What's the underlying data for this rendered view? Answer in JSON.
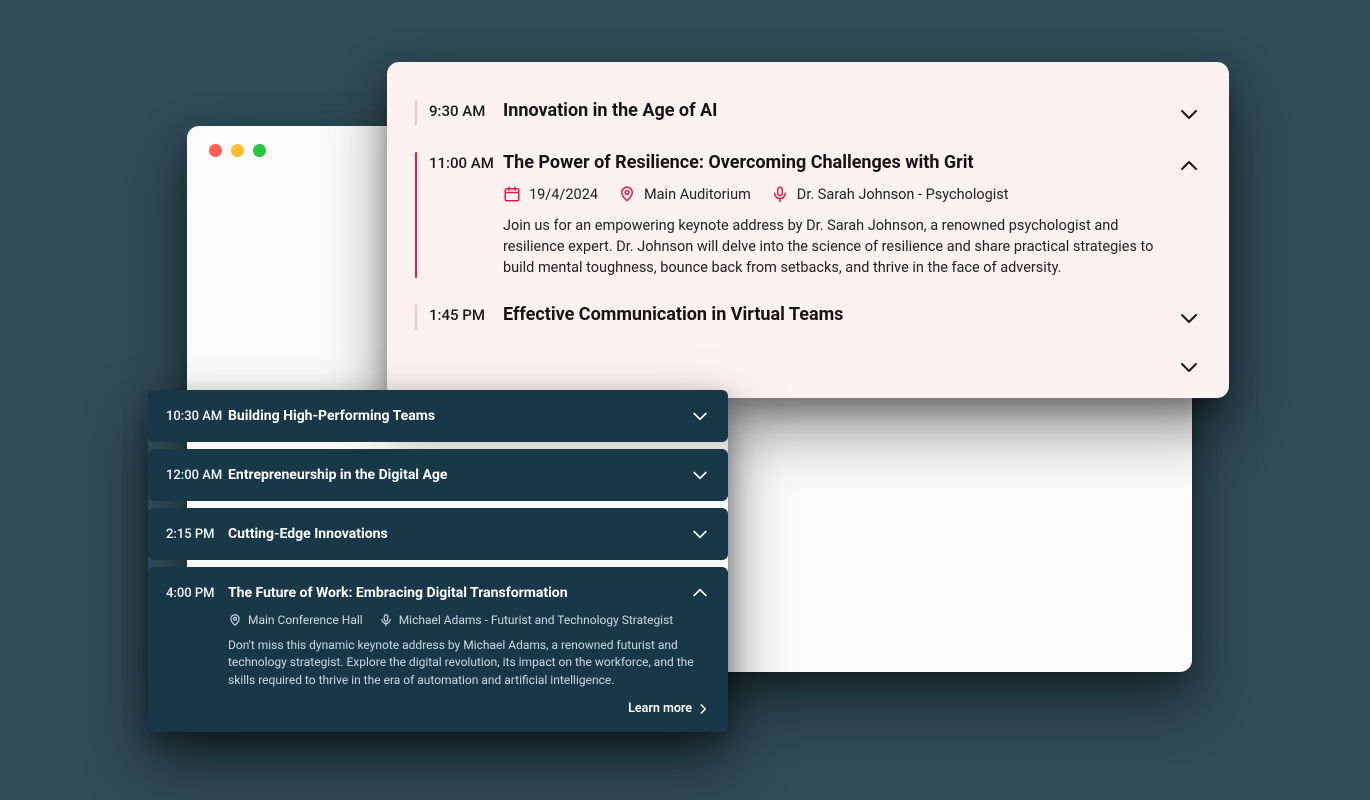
{
  "colors": {
    "page_bg": "#2f4c57",
    "light_card_bg": "#fdf1f2",
    "light_accent": "#e11d48",
    "dark_card_bg": "#18384a"
  },
  "lightCard": {
    "items": [
      {
        "time": "9:30 AM",
        "title": "Innovation in the Age of AI",
        "expanded": false
      },
      {
        "time": "11:00 AM",
        "title": "The Power of Resilience: Overcoming Challenges with Grit",
        "expanded": true,
        "date": "19/4/2024",
        "location": "Main Auditorium",
        "speaker": "Dr. Sarah Johnson - Psychologist",
        "description": "Join us for an empowering keynote address by Dr. Sarah Johnson, a renowned psychologist and resilience expert. Dr. Johnson will delve into the science of resilience and share practical strategies to build mental toughness, bounce back from setbacks, and thrive in the face of adversity."
      },
      {
        "time": "1:45 PM",
        "title": "Effective Communication in Virtual Teams",
        "expanded": false
      }
    ]
  },
  "darkCard": {
    "items": [
      {
        "time": "10:30 AM",
        "title": "Building High-Performing Teams",
        "expanded": false
      },
      {
        "time": "12:00 AM",
        "title": "Entrepreneurship in the Digital Age",
        "expanded": false
      },
      {
        "time": "2:15 PM",
        "title": "Cutting-Edge Innovations",
        "expanded": false
      },
      {
        "time": "4:00 PM",
        "title": "The Future of Work: Embracing Digital Transformation",
        "expanded": true,
        "location": "Main Conference Hall",
        "speaker": "Michael Adams - Futurist and Technology Strategist",
        "description": "Don't miss this dynamic keynote address by Michael Adams, a renowned futurist and technology strategist. Explore the digital revolution, its impact on the workforce, and the skills required to thrive in the era of automation and artificial intelligence.",
        "learn_more_label": "Learn more"
      }
    ]
  }
}
